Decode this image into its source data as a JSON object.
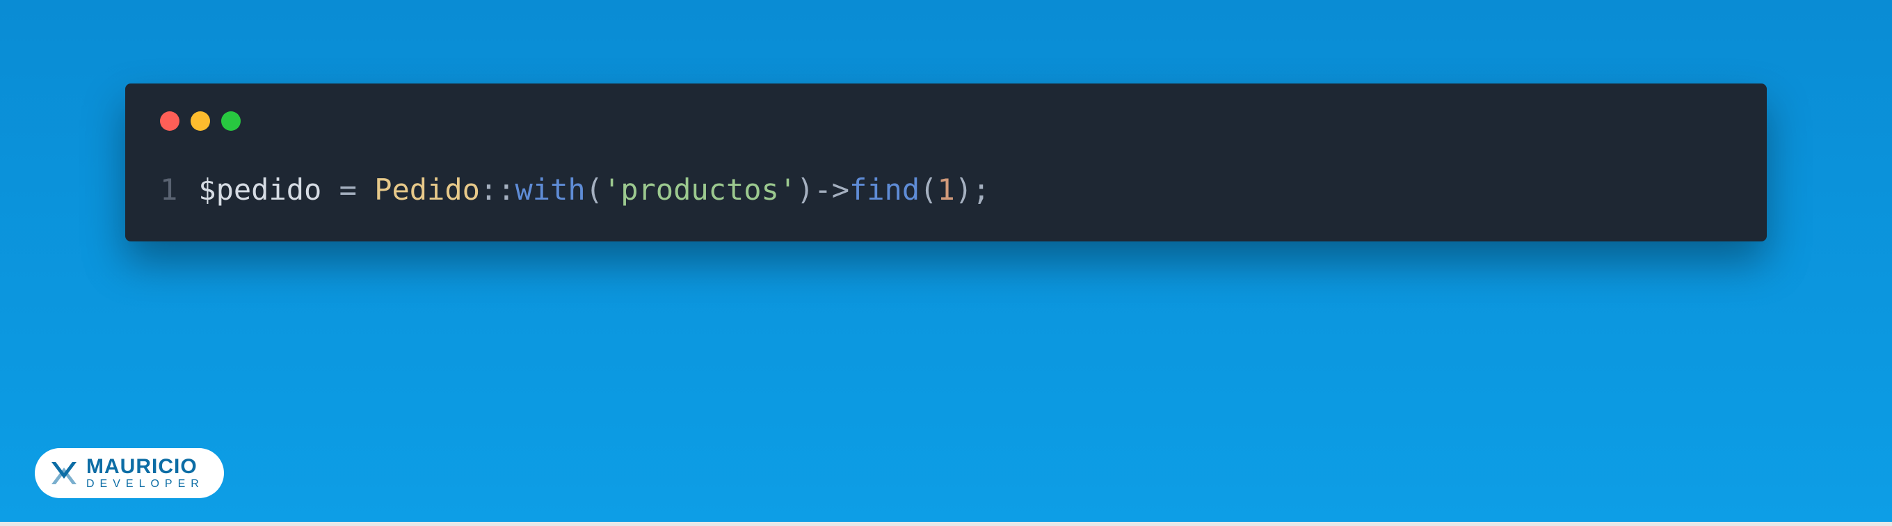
{
  "code": {
    "line_number": "1",
    "variable": "$pedido",
    "assign_space1": " ",
    "assign": "=",
    "assign_space2": " ",
    "class": "Pedido",
    "scope": "::",
    "method1": "with",
    "paren_open1": "(",
    "string": "'productos'",
    "paren_close1": ")",
    "arrow": "->",
    "method2": "find",
    "paren_open2": "(",
    "number": "1",
    "paren_close2": ")",
    "semi": ";"
  },
  "logo": {
    "name": "MAURICIO",
    "subtitle": "DEVELOPER"
  }
}
